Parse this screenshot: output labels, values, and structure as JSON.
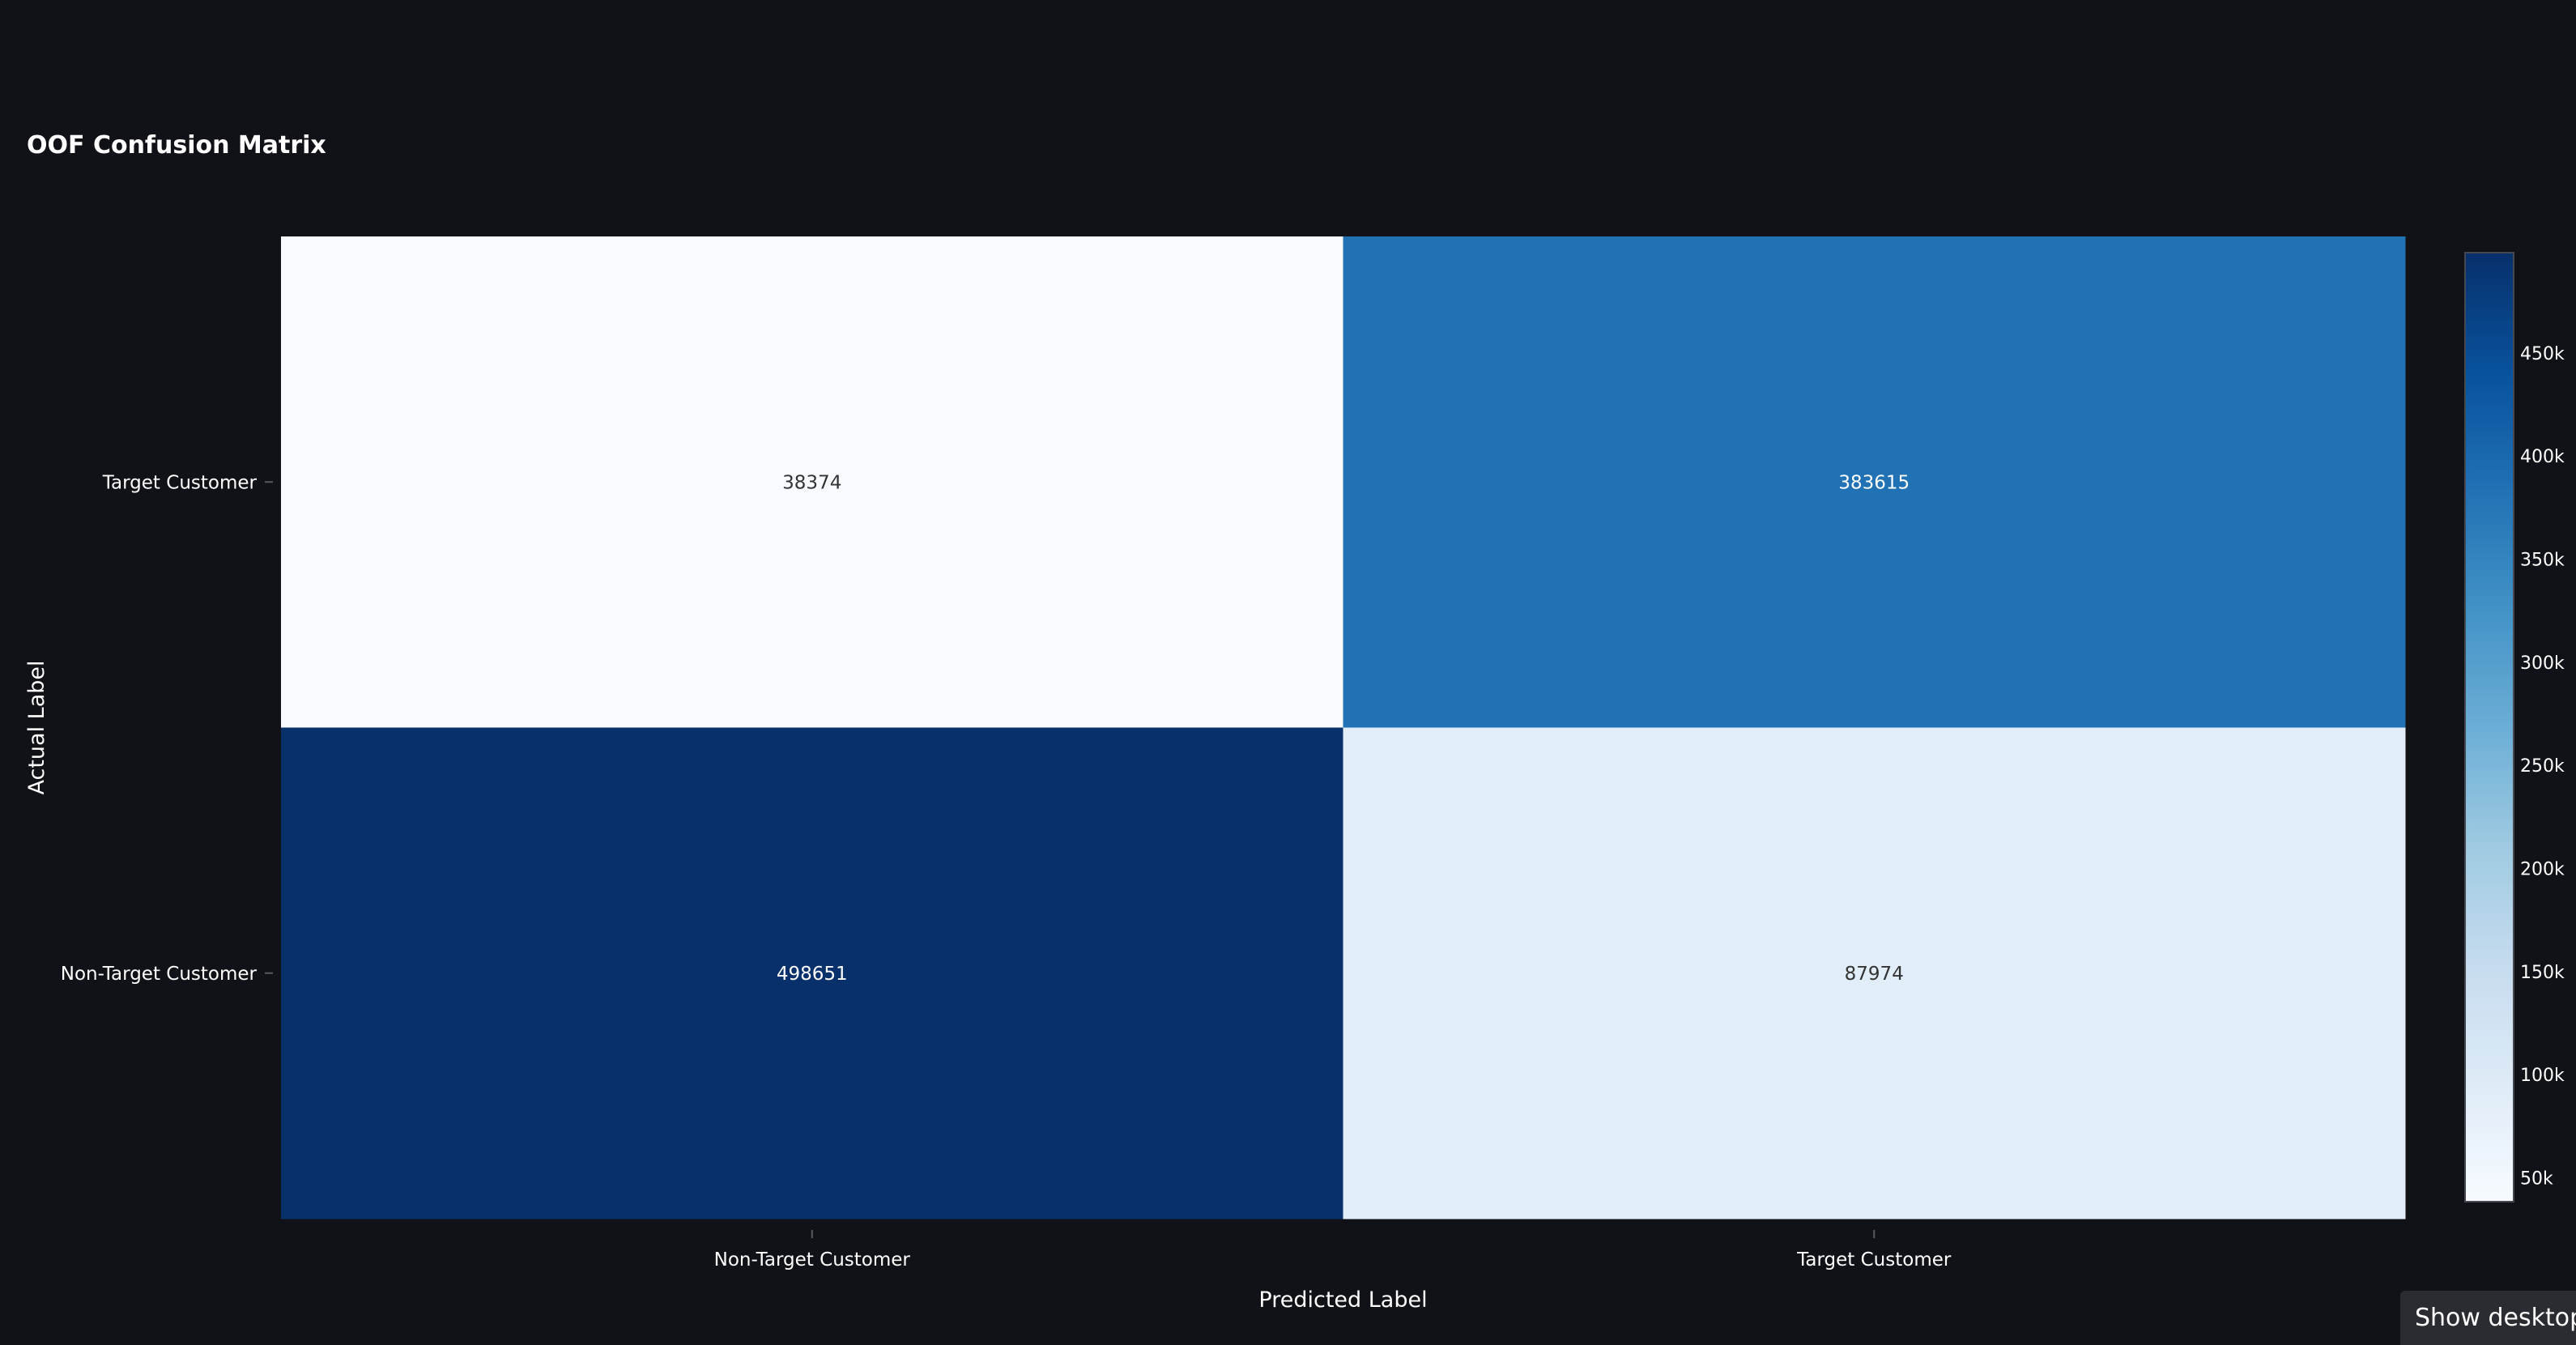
{
  "chart_data": {
    "type": "heatmap",
    "title": "OOF Confusion Matrix",
    "xlabel": "Predicted Label",
    "ylabel": "Actual Label",
    "x_categories": [
      "Non-Target Customer",
      "Target Customer"
    ],
    "y_categories": [
      "Target Customer",
      "Non-Target Customer"
    ],
    "values": [
      [
        38374,
        383615
      ],
      [
        498651,
        87974
      ]
    ],
    "colorscale": "Blues",
    "colorbar": {
      "range": [
        38374,
        498651
      ],
      "ticks": [
        50000,
        100000,
        150000,
        200000,
        250000,
        300000,
        350000,
        400000,
        450000
      ],
      "tick_labels": [
        "50k",
        "100k",
        "150k",
        "200k",
        "250k",
        "300k",
        "350k",
        "400k",
        "450k"
      ]
    },
    "colors": {
      "low": "#f7fbff",
      "high": "#1e2f66",
      "background": "#111217"
    }
  },
  "overlay": {
    "show_desktop_label": "Show desktop"
  }
}
